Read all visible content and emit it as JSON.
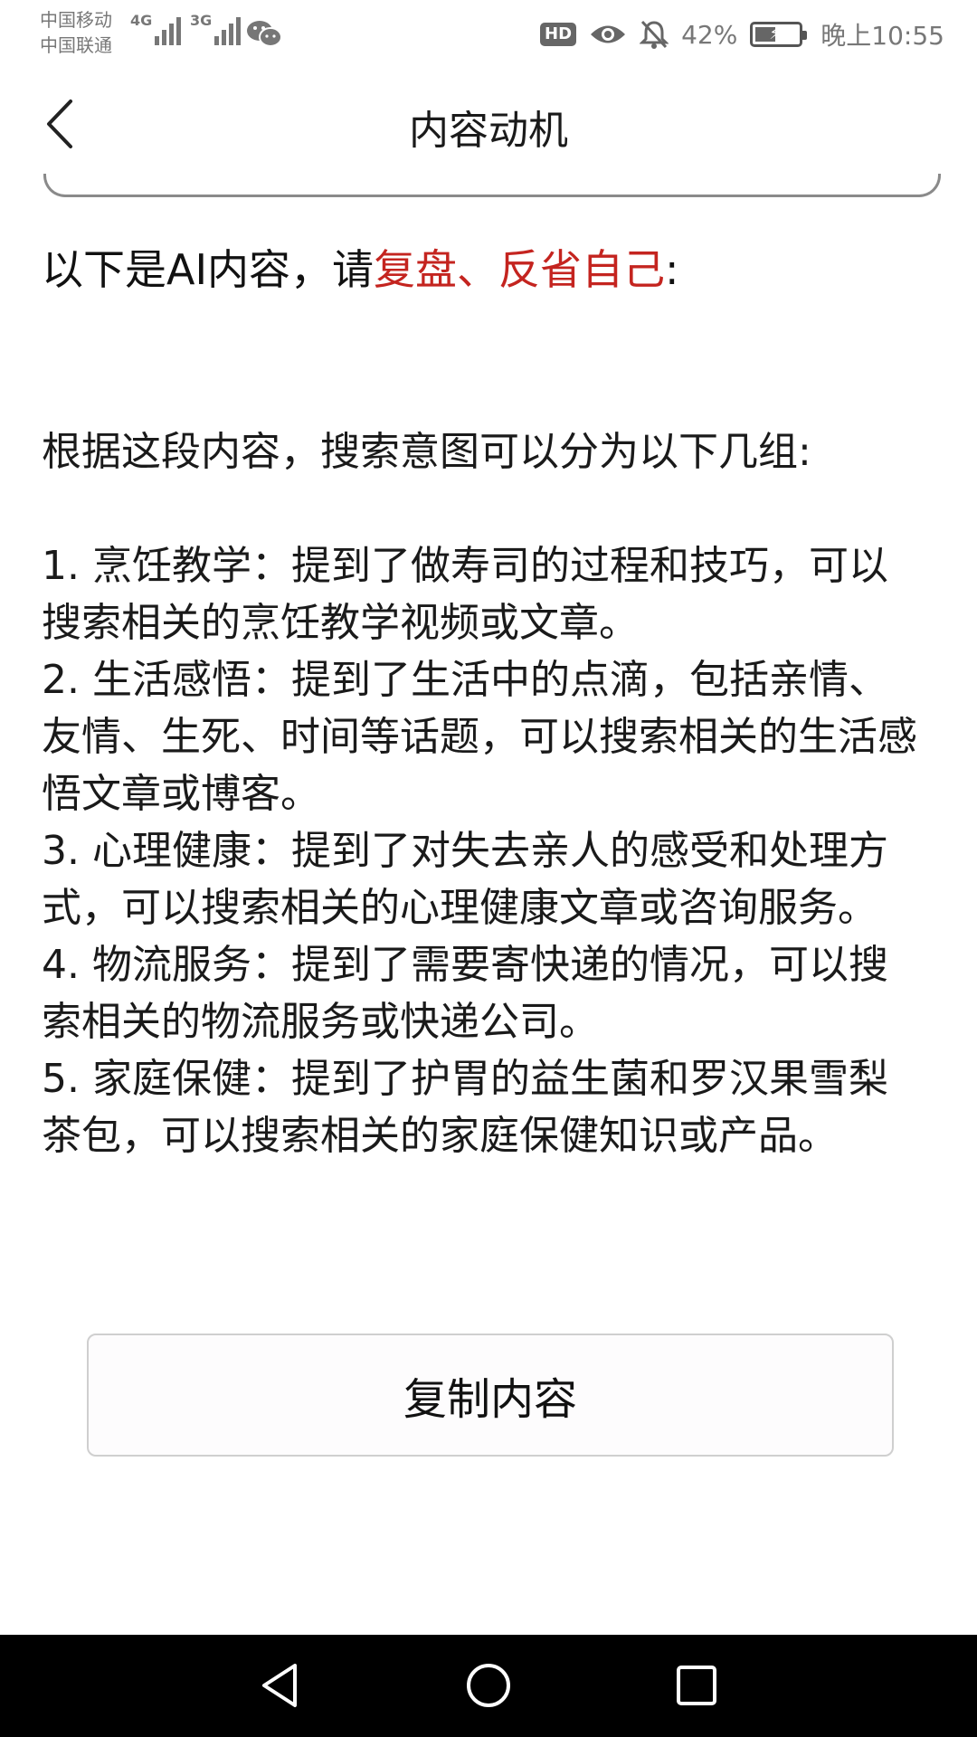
{
  "status_bar": {
    "carrier_1": "中国移动",
    "carrier_2": "中国联通",
    "network_1": "4G",
    "network_2": "3G",
    "hd_label": "HD",
    "battery_percent": "42%",
    "battery_level": 0.42,
    "time": "晚上10:55",
    "icons": [
      "signal-icon",
      "wechat-icon",
      "eye-icon",
      "bell-off-icon",
      "battery-icon"
    ]
  },
  "header": {
    "title": "内容动机",
    "back_icon": "chevron-left-icon"
  },
  "content": {
    "intro_prefix": "以下是AI内容，请",
    "intro_emphasis": "复盘、反省自己",
    "intro_suffix": ":",
    "emphasis_color": "#c4241f",
    "lead": "根据这段内容，搜索意图可以分为以下几组:",
    "items": [
      "1. 烹饪教学：提到了做寿司的过程和技巧，可以搜索相关的烹饪教学视频或文章。",
      "2. 生活感悟：提到了生活中的点滴，包括亲情、友情、生死、时间等话题，可以搜索相关的生活感悟文章或博客。",
      "3. 心理健康：提到了对失去亲人的感受和处理方式，可以搜索相关的心理健康文章或咨询服务。",
      "4. 物流服务：提到了需要寄快递的情况，可以搜索相关的物流服务或快递公司。",
      "5. 家庭保健：提到了护胃的益生菌和罗汉果雪梨茶包，可以搜索相关的家庭保健知识或产品。"
    ]
  },
  "actions": {
    "copy_label": "复制内容"
  },
  "nav_bar": {
    "icons": [
      "back-triangle-icon",
      "home-circle-icon",
      "recents-square-icon"
    ]
  }
}
